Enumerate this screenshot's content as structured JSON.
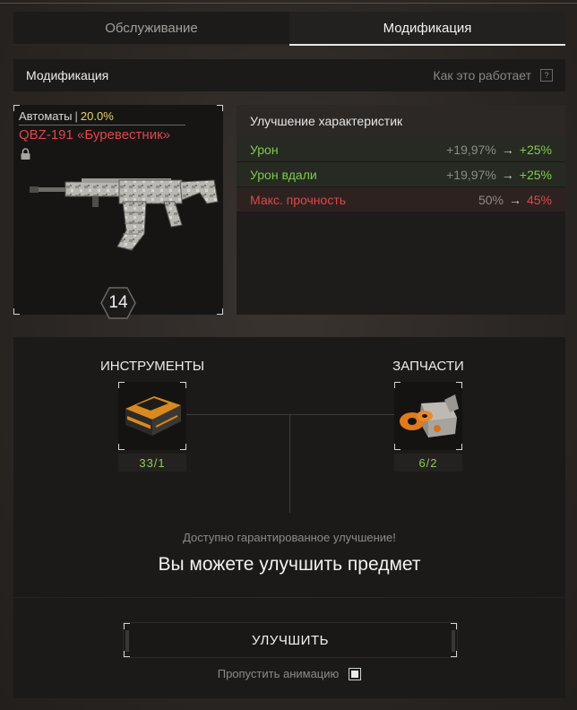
{
  "tabs": [
    {
      "label": "Обслуживание",
      "active": false
    },
    {
      "label": "Модификация",
      "active": true
    }
  ],
  "section": {
    "title": "Модификация",
    "how_it_works": "Как это работает",
    "help_glyph": "?"
  },
  "weapon": {
    "category": "Автоматы",
    "separator": "|",
    "percent": "20.0%",
    "name": "QBZ-191 «Буревестник»",
    "locked": true,
    "level": "14",
    "icons": {
      "lock": "lock-icon",
      "image": "rifle-image"
    }
  },
  "stats": {
    "title": "Улучшение характеристик",
    "arrow": "→",
    "rows": [
      {
        "label": "Урон",
        "old": "+19,97%",
        "new": "+25%",
        "kind": "good"
      },
      {
        "label": "Урон вдали",
        "old": "+19,97%",
        "new": "+25%",
        "kind": "good"
      },
      {
        "label": "Макс. прочность",
        "old": "50%",
        "new": "45%",
        "kind": "bad"
      }
    ]
  },
  "materials": {
    "tools": {
      "title": "ИНСТРУМЕНТЫ",
      "count": "33/1",
      "icon": "toolbox-icon"
    },
    "parts": {
      "title": "ЗАПЧАСТИ",
      "count": "6/2",
      "icon": "spare-parts-icon"
    },
    "guaranteed": "Доступно гарантированное улучшение!",
    "can_upgrade": "Вы можете улучшить предмет"
  },
  "actions": {
    "upgrade": "УЛУЧШИТЬ",
    "skip_animation": "Пропустить анимацию",
    "skip_checked": true
  },
  "colors": {
    "good": "#7fcb4f",
    "bad": "#e0474b",
    "accent_yellow": "#e6d36a",
    "weapon_name": "#e0464b"
  }
}
